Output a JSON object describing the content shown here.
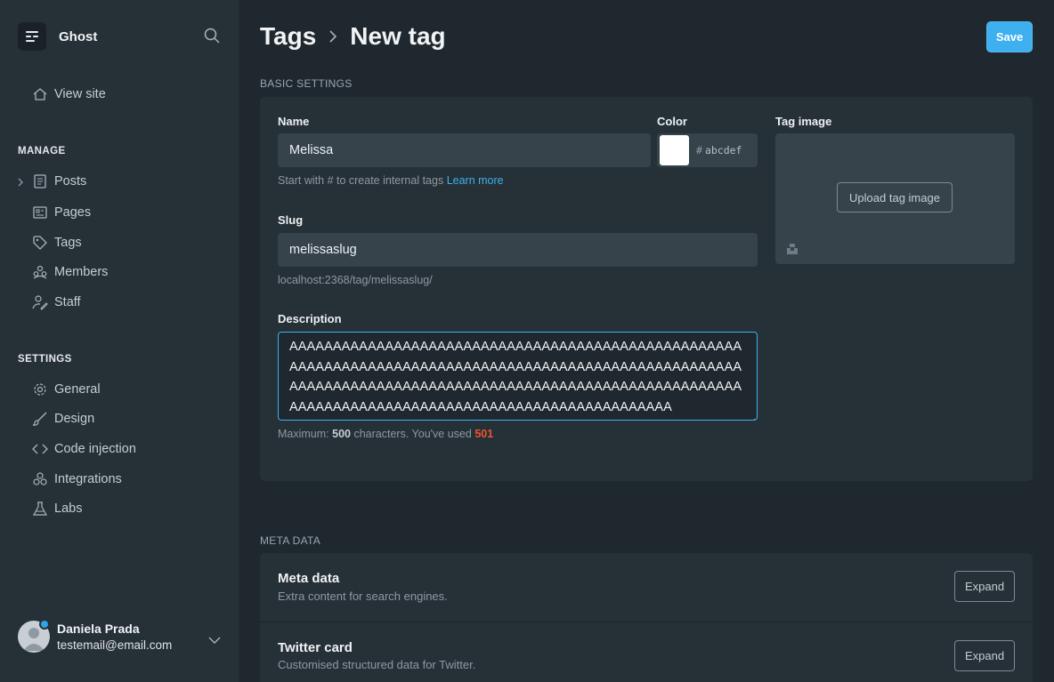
{
  "sidebar": {
    "brand": "Ghost",
    "view_site": "View site",
    "manage_label": "MANAGE",
    "manage_items": [
      "Posts",
      "Pages",
      "Tags",
      "Members",
      "Staff"
    ],
    "settings_label": "SETTINGS",
    "settings_items": [
      "General",
      "Design",
      "Code injection",
      "Integrations",
      "Labs"
    ],
    "user": {
      "name": "Daniela Prada",
      "email": "testemail@email.com"
    }
  },
  "header": {
    "crumb_parent": "Tags",
    "crumb_current": "New tag",
    "save_label": "Save"
  },
  "basic": {
    "section_label": "BASIC SETTINGS",
    "name_label": "Name",
    "name_value": "Melissa",
    "name_hint": "Start with # to create internal tags",
    "name_hint_link": "Learn more",
    "color_label": "Color",
    "color_hash": "#",
    "color_value": "abcdef",
    "image_label": "Tag image",
    "upload_label": "Upload tag image",
    "slug_label": "Slug",
    "slug_value": "melissaslug",
    "slug_url": "localhost:2368/tag/melissaslug/",
    "desc_label": "Description",
    "desc_value": "AAAAAAAAAAAAAAAAAAAAAAAAAAAAAAAAAAAAAAAAAAAAAAAAAAAAAAAAAAAAAAAAAAAAAAAAAAAAAAAAAAAAAAAAAAAAAAAAAAAAAAAAAAAAAAAAAAAAAAAAAAAAAAAAAAAAAAAAAAAAAAAAAAAAAAAAAAAAAAAAAAAAAAAAAAAAAAAAAAAAAAAAAAAAAAAAAAAAAAAA",
    "desc_hint_pre": "Maximum:",
    "desc_max": "500",
    "desc_hint_mid": "characters. You've used",
    "desc_used": "501"
  },
  "meta": {
    "section_label": "META DATA",
    "rows": [
      {
        "title": "Meta data",
        "subtitle": "Extra content for search engines.",
        "button": "Expand"
      },
      {
        "title": "Twitter card",
        "subtitle": "Customised structured data for Twitter.",
        "button": "Expand"
      }
    ]
  },
  "colors": {
    "accent": "#3eb0ef",
    "error": "#f05230",
    "background": "#1f282e",
    "sidebar": "#263037"
  }
}
